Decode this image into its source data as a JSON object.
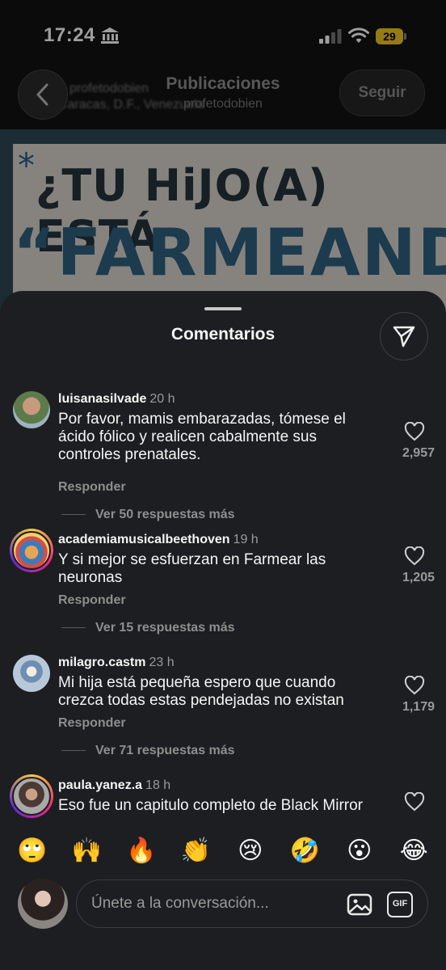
{
  "status_bar": {
    "time": "17:24",
    "battery": "29",
    "icons": [
      "bank-icon",
      "signal-icon",
      "wifi-icon",
      "battery-icon"
    ]
  },
  "nav": {
    "title": "Publicaciones",
    "subtitle": "profetodobien",
    "profile_name": "profetodobien",
    "profile_location": "Caracas, D.F., Venezuela",
    "follow_label": "Seguir"
  },
  "post": {
    "line1": "¿TU HiJO(A) ESTÁ",
    "line2": "“FARMEANDO”",
    "star": "*"
  },
  "comments_sheet": {
    "title": "Comentarios",
    "comments": [
      {
        "user": "luisanasilvade",
        "time": "20 h",
        "text": "Por favor, mamis embarazadas, tómese el ácido fólico y realicen cabalmente sus controles prenatales.",
        "reply_label": "Responder",
        "more_label": "Ver 50 respuestas más",
        "likes": "2,957"
      },
      {
        "user": "academiamusicalbeethoven",
        "time": "19 h",
        "text": "Y si mejor se esfuerzan en Farmear las neuronas",
        "reply_label": "Responder",
        "more_label": "Ver 15 respuestas más",
        "likes": "1,205"
      },
      {
        "user": "milagro.castm",
        "time": "23 h",
        "text": "Mi hija está pequeña espero que cuando crezca todas estas pendejadas no existan",
        "reply_label": "Responder",
        "more_label": "Ver 71 respuestas más",
        "likes": "1,179"
      },
      {
        "user": "paula.yanez.a",
        "time": "18 h",
        "text": "Eso fue un capitulo completo de Black Mirror",
        "likes": ""
      }
    ]
  },
  "reactions": [
    "🙄",
    "🙌",
    "🔥",
    "👏",
    "😢",
    "🤣",
    "😮",
    "😂"
  ],
  "composer": {
    "placeholder": "Únete a la conversación...",
    "gif_label": "GIF"
  }
}
